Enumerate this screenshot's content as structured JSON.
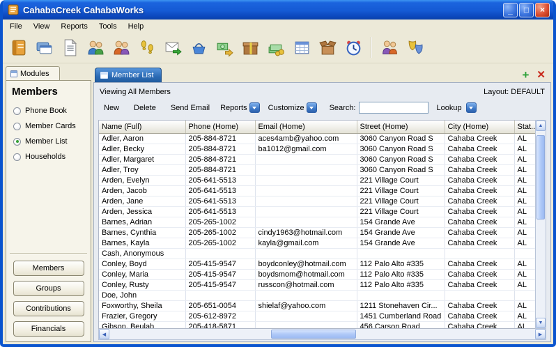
{
  "window": {
    "title": "CahabaCreek CahabaWorks",
    "minimize_glyph": "_",
    "maximize_glyph": "□",
    "close_glyph": "×"
  },
  "menu": {
    "items": [
      "File",
      "View",
      "Reports",
      "Tools",
      "Help"
    ]
  },
  "toolbar": {
    "icons": [
      "phone-book",
      "member-cards",
      "report-document",
      "members",
      "visitors",
      "attendance-footprints",
      "send-email",
      "offering-basket",
      "contributions-money-arrow",
      "gift-box",
      "money-stack",
      "batch-grid",
      "open-box",
      "alarm-clock",
      "family",
      "theater-masks"
    ]
  },
  "sidebar": {
    "tab_label": "Modules",
    "heading": "Members",
    "options": [
      {
        "label": "Phone Book",
        "selected": false
      },
      {
        "label": "Member Cards",
        "selected": false
      },
      {
        "label": "Member List",
        "selected": true
      },
      {
        "label": "Households",
        "selected": false
      }
    ],
    "buttons": [
      "Members",
      "Groups",
      "Contributions",
      "Financials"
    ]
  },
  "main": {
    "tab_label": "Member List",
    "status_text": "Viewing All Members",
    "layout_text": "Layout: DEFAULT",
    "actions": {
      "new_label": "New",
      "delete_label": "Delete",
      "send_email_label": "Send Email",
      "reports_label": "Reports",
      "customize_label": "Customize",
      "search_label": "Search:",
      "search_value": "",
      "lookup_label": "Lookup"
    },
    "table": {
      "columns": [
        "Name (Full)",
        "Phone (Home)",
        "Email (Home)",
        "Street (Home)",
        "City (Home)",
        "Stat..."
      ],
      "rows": [
        [
          "Adler, Aaron",
          "205-884-8721",
          "aces4amb@yahoo.com",
          "3060 Canyon Road S",
          "Cahaba Creek",
          "AL"
        ],
        [
          "Adler, Becky",
          "205-884-8721",
          "ba1012@gmail.com",
          "3060 Canyon Road S",
          "Cahaba Creek",
          "AL"
        ],
        [
          "Adler, Margaret",
          "205-884-8721",
          "",
          "3060 Canyon Road S",
          "Cahaba Creek",
          "AL"
        ],
        [
          "Adler, Troy",
          "205-884-8721",
          "",
          "3060 Canyon Road S",
          "Cahaba Creek",
          "AL"
        ],
        [
          "Arden, Evelyn",
          "205-641-5513",
          "",
          "221 Village Court",
          "Cahaba Creek",
          "AL"
        ],
        [
          "Arden, Jacob",
          "205-641-5513",
          "",
          "221 Village Court",
          "Cahaba Creek",
          "AL"
        ],
        [
          "Arden, Jane",
          "205-641-5513",
          "",
          "221 Village Court",
          "Cahaba Creek",
          "AL"
        ],
        [
          "Arden, Jessica",
          "205-641-5513",
          "",
          "221 Village Court",
          "Cahaba Creek",
          "AL"
        ],
        [
          "Barnes, Adrian",
          "205-265-1002",
          "",
          "154 Grande Ave",
          "Cahaba Creek",
          "AL"
        ],
        [
          "Barnes, Cynthia",
          "205-265-1002",
          "cindy1963@hotmail.com",
          "154 Grande Ave",
          "Cahaba Creek",
          "AL"
        ],
        [
          "Barnes, Kayla",
          "205-265-1002",
          "kayla@gmail.com",
          "154 Grande Ave",
          "Cahaba Creek",
          "AL"
        ],
        [
          "Cash, Anonymous",
          "",
          "",
          "",
          "",
          ""
        ],
        [
          "Conley, Boyd",
          "205-415-9547",
          "boydconley@hotmail.com",
          "112 Palo Alto #335",
          "Cahaba Creek",
          "AL"
        ],
        [
          "Conley, Maria",
          "205-415-9547",
          "boydsmom@hotmail.com",
          "112 Palo Alto #335",
          "Cahaba Creek",
          "AL"
        ],
        [
          "Conley, Rusty",
          "205-415-9547",
          "russcon@hotmail.com",
          "112 Palo Alto #335",
          "Cahaba Creek",
          "AL"
        ],
        [
          "Doe, John",
          "",
          "",
          "",
          "",
          ""
        ],
        [
          "Foxworthy, Sheila",
          "205-651-0054",
          "shielaf@yahoo.com",
          "1211 Stonehaven Cir...",
          "Cahaba Creek",
          "AL"
        ],
        [
          "Frazier, Gregory",
          "205-612-8972",
          "",
          "1451 Cumberland Road",
          "Cahaba Creek",
          "AL"
        ],
        [
          "Gibson, Beulah",
          "205-418-5871",
          "",
          "456 Carson Road",
          "Cahaba Creek",
          "AL"
        ]
      ]
    }
  },
  "scrollbar": {
    "up": "▲",
    "down": "▼",
    "left": "◀",
    "right": "▶"
  },
  "colors": {
    "titlebar_blue": "#1557D6",
    "window_border": "#0A54CE",
    "active_tab_blue": "#2B6AB4",
    "panel_bg": "#E7EBF1",
    "add_view_green": "#2FA23B",
    "close_view_red": "#C92A1C"
  }
}
